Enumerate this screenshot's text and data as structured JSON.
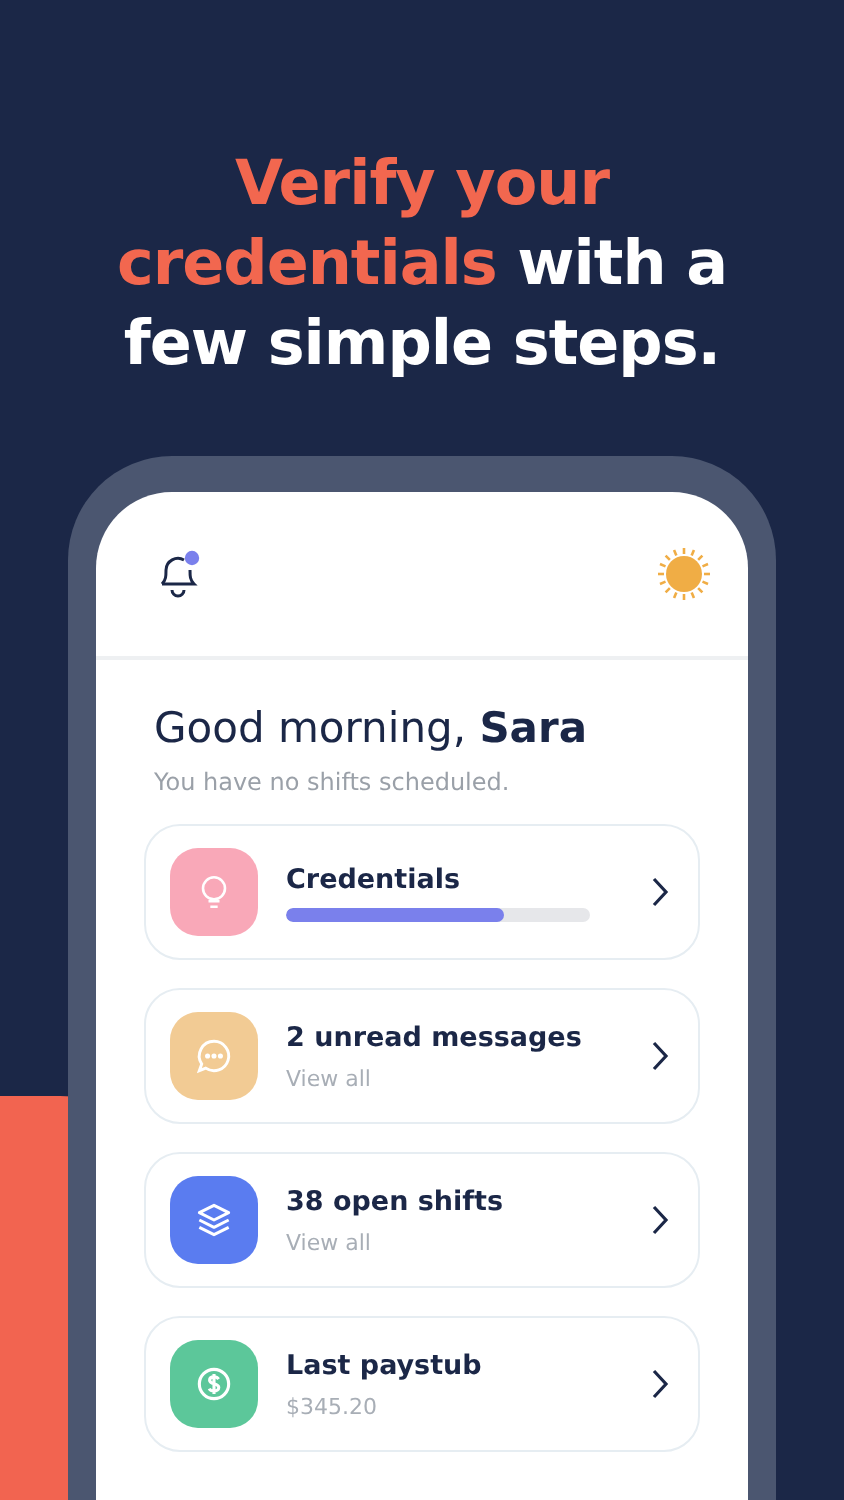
{
  "headline": [
    {
      "text": "Verify your credentials",
      "accent": true
    },
    {
      "text": " with a few simple steps.",
      "accent": false
    }
  ],
  "header": {
    "notification_dot": true
  },
  "greeting": "Good morning, **Sara**",
  "subtitle": "You have no shifts scheduled.",
  "cards": [
    {
      "kind": "progress",
      "color": "#f9a8b8",
      "title": "Credentials",
      "level": 0.72
    },
    {
      "kind": "subtitle",
      "color": "#f2cb94",
      "title": "2 unread messages",
      "subtitle": "View all"
    },
    {
      "kind": "subtitle",
      "color": "#5a7cf0",
      "title": "38 open shifts",
      "subtitle": "View all"
    },
    {
      "kind": "subtitle",
      "color": "#5cc79a",
      "title": "Last paystub",
      "subtitle": "$345.20"
    }
  ]
}
